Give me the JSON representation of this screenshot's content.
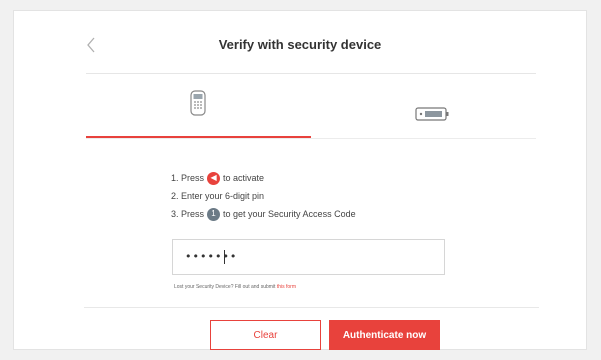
{
  "header": {
    "title": "Verify with security device",
    "back_icon": "chevron-left-icon"
  },
  "tabs": [
    {
      "icon": "security-token-icon",
      "active": true
    },
    {
      "icon": "card-reader-icon",
      "active": false
    }
  ],
  "instructions": {
    "step1_before": "1. Press",
    "step1_after": "to activate",
    "step2": "2. Enter your 6-digit pin",
    "step3_before": "3. Press",
    "step3_after": "to get your Security Access Code"
  },
  "pin_input": {
    "value": "•••••••"
  },
  "lost_device": {
    "text": "Lost your Security Device? Fill out and submit",
    "link": "this form"
  },
  "buttons": {
    "clear": "Clear",
    "authenticate": "Authenticate now"
  },
  "colors": {
    "accent": "#e8423c",
    "badge_grey": "#6b7a86"
  }
}
